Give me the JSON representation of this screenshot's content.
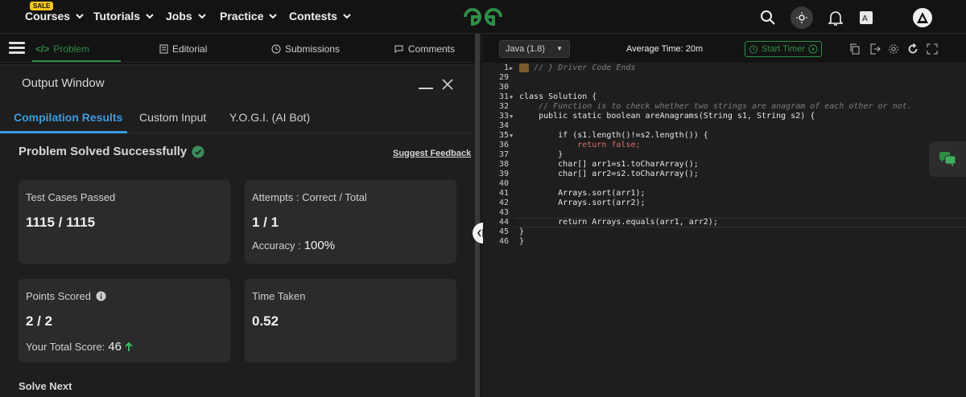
{
  "nav": {
    "sale_badge": "SALE",
    "items": [
      "Courses",
      "Tutorials",
      "Jobs",
      "Practice",
      "Contests"
    ],
    "colors": {
      "brand": "#2f8d46",
      "accent": "#3b9ce0"
    }
  },
  "problem_tabs": [
    "Problem",
    "Editorial",
    "Submissions",
    "Comments"
  ],
  "output_window": {
    "title": "Output Window",
    "tabs": [
      "Compilation Results",
      "Custom Input",
      "Y.O.G.I. (AI Bot)"
    ],
    "status": "Problem Solved Successfully",
    "suggest_feedback": "Suggest Feedback",
    "cards": {
      "test_cases": {
        "label": "Test Cases Passed",
        "value": "1115 / 1115"
      },
      "attempts": {
        "label": "Attempts : Correct / Total",
        "value": "1 / 1",
        "sub_label": "Accuracy :",
        "sub_value": "100%"
      },
      "points": {
        "label": "Points Scored",
        "value": "2 / 2",
        "sub_label": "Your Total Score:",
        "sub_value": "46"
      },
      "time": {
        "label": "Time Taken",
        "value": "0.52"
      }
    },
    "solve_next": "Solve Next"
  },
  "editor": {
    "language": "Java (1.8)",
    "average_time": "Average Time: 20m",
    "start_timer": "Start Timer",
    "lines": [
      {
        "n": "1",
        "text": "// } Driver Code Ends"
      },
      {
        "n": "29",
        "text": ""
      },
      {
        "n": "30",
        "text": ""
      },
      {
        "n": "31",
        "text": "class Solution {"
      },
      {
        "n": "32",
        "text": "    // Function is to check whether two strings are anagram of each other or not."
      },
      {
        "n": "33",
        "text": "    public static boolean areAnagrams(String s1, String s2) {"
      },
      {
        "n": "34",
        "text": ""
      },
      {
        "n": "35",
        "text": "        if (s1.length()!=s2.length()) {"
      },
      {
        "n": "36",
        "text": "            return false;"
      },
      {
        "n": "37",
        "text": "        }"
      },
      {
        "n": "38",
        "text": "        char[] arr1=s1.toCharArray();"
      },
      {
        "n": "39",
        "text": "        char[] arr2=s2.toCharArray();"
      },
      {
        "n": "40",
        "text": ""
      },
      {
        "n": "41",
        "text": "        Arrays.sort(arr1);"
      },
      {
        "n": "42",
        "text": "        Arrays.sort(arr2);"
      },
      {
        "n": "43",
        "text": ""
      },
      {
        "n": "44",
        "text": "        return Arrays.equals(arr1, arr2);"
      },
      {
        "n": "45",
        "text": "}"
      },
      {
        "n": "46",
        "text": "}"
      }
    ]
  }
}
